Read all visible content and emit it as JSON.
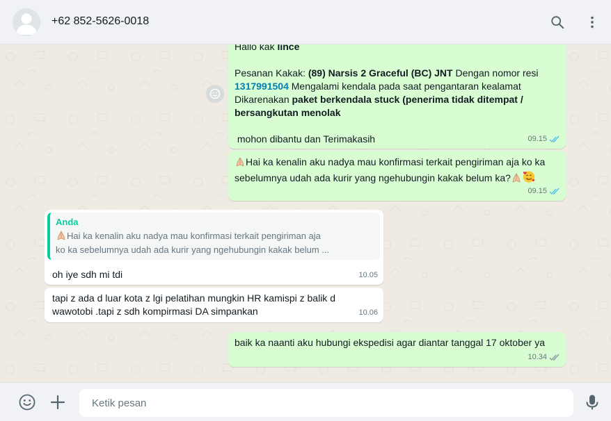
{
  "header": {
    "contact_name": "+62 852-5626-0018",
    "icons": [
      "avatar",
      "search-icon",
      "menu-icon"
    ]
  },
  "messages": [
    {
      "direction": "outgoing",
      "lines": {
        "greeting_prefix": "Hallo kak ",
        "greeting_name": "lince",
        "order_prefix": "Pesanan Kakak: ",
        "order_bold": "(89) Narsis 2 Graceful (BC) JNT",
        "order_suffix": " Dengan nomor resi",
        "tracking_number": "1317991504",
        "tracking_suffix": " Mengalami kendala pada saat pengantaran kealamat",
        "reason_prefix": "Dikarenakan ",
        "reason_bold_1": "paket berkendala stuck (penerima tidak ditempat /",
        "reason_bold_2": "bersangkutan menolak",
        "closing": " mohon dibantu dan Terimakasih"
      },
      "time": "09.15",
      "status": "read"
    },
    {
      "direction": "outgoing",
      "text_1": "Hai ka kenalin aku nadya mau konfirmasi terkait pengiriman aja ko ka",
      "text_2": "sebelumnya udah ada kurir yang ngehubungin kakak belum ka?",
      "emojis": [
        "folded-hands",
        "folded-hands",
        "smiling-face-with-hearts"
      ],
      "time": "09.15",
      "status": "read"
    },
    {
      "direction": "incoming",
      "quote": {
        "author": "Anda",
        "line_1": "Hai ka kenalin aku nadya mau konfirmasi terkait pengiriman aja",
        "line_2": "ko ka sebelumnya udah ada kurir yang ngehubungin kakak belum ..."
      },
      "text": "oh iye sdh mi tdi",
      "time": "10.05"
    },
    {
      "direction": "incoming",
      "text_1": "tapi z ada d luar kota z lgi pelatihan mungkin HR kamispi z balik d",
      "text_2": "wawotobi .tapi z sdh kompirmasi DA simpankan",
      "time": "10.06"
    },
    {
      "direction": "outgoing",
      "text": "baik ka naanti aku hubungi ekspedisi agar diantar tanggal 17 oktober ya",
      "time": "10.34",
      "status": "delivered"
    }
  ],
  "footer": {
    "placeholder": "Ketik pesan",
    "icons": [
      "emoji-icon",
      "attach-plus-icon",
      "microphone-icon"
    ]
  },
  "colors": {
    "outgoing_bubble": "#d9fdd3",
    "incoming_bubble": "#ffffff",
    "chat_background": "#efeae2",
    "read_ticks": "#53bdeb",
    "delivered_ticks": "#8696a0",
    "quote_accent": "#06cf9c",
    "link": "#027eb5"
  }
}
